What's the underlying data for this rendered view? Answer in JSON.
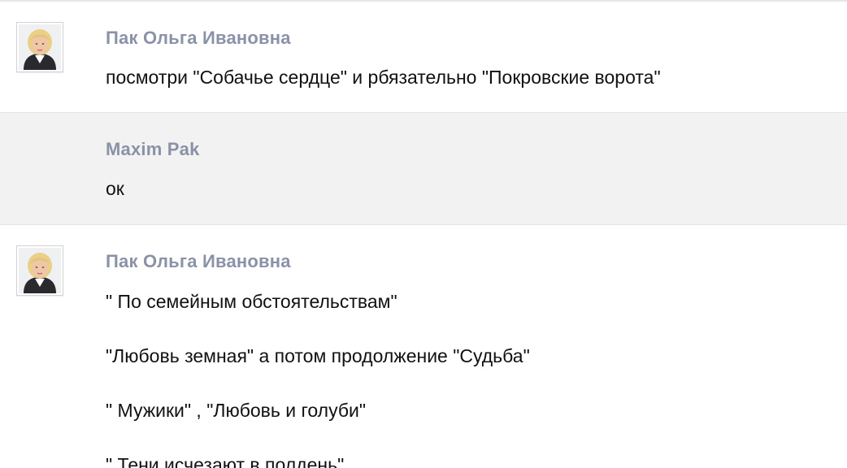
{
  "messages": [
    {
      "author": "Пак Ольга Ивановна",
      "has_avatar": true,
      "lines": [
        "посмотри \"Собачье сердце\" и рбязательно \"Покровские ворота\""
      ]
    },
    {
      "author": "Maxim Pak",
      "has_avatar": false,
      "lines": [
        "ок"
      ]
    },
    {
      "author": "Пак Ольга Ивановна",
      "has_avatar": true,
      "lines": [
        "\" По семейным обстоятельствам\"",
        "\"Любовь земная\" а потом продолжение \"Судьба\"",
        "\" Мужики\" , \"Любовь и голуби\"",
        "\" Тени исчезают в полдень\""
      ]
    }
  ],
  "colors": {
    "author": "#8a92a8",
    "text": "#111111",
    "alt_row_bg": "#f2f2f2"
  }
}
